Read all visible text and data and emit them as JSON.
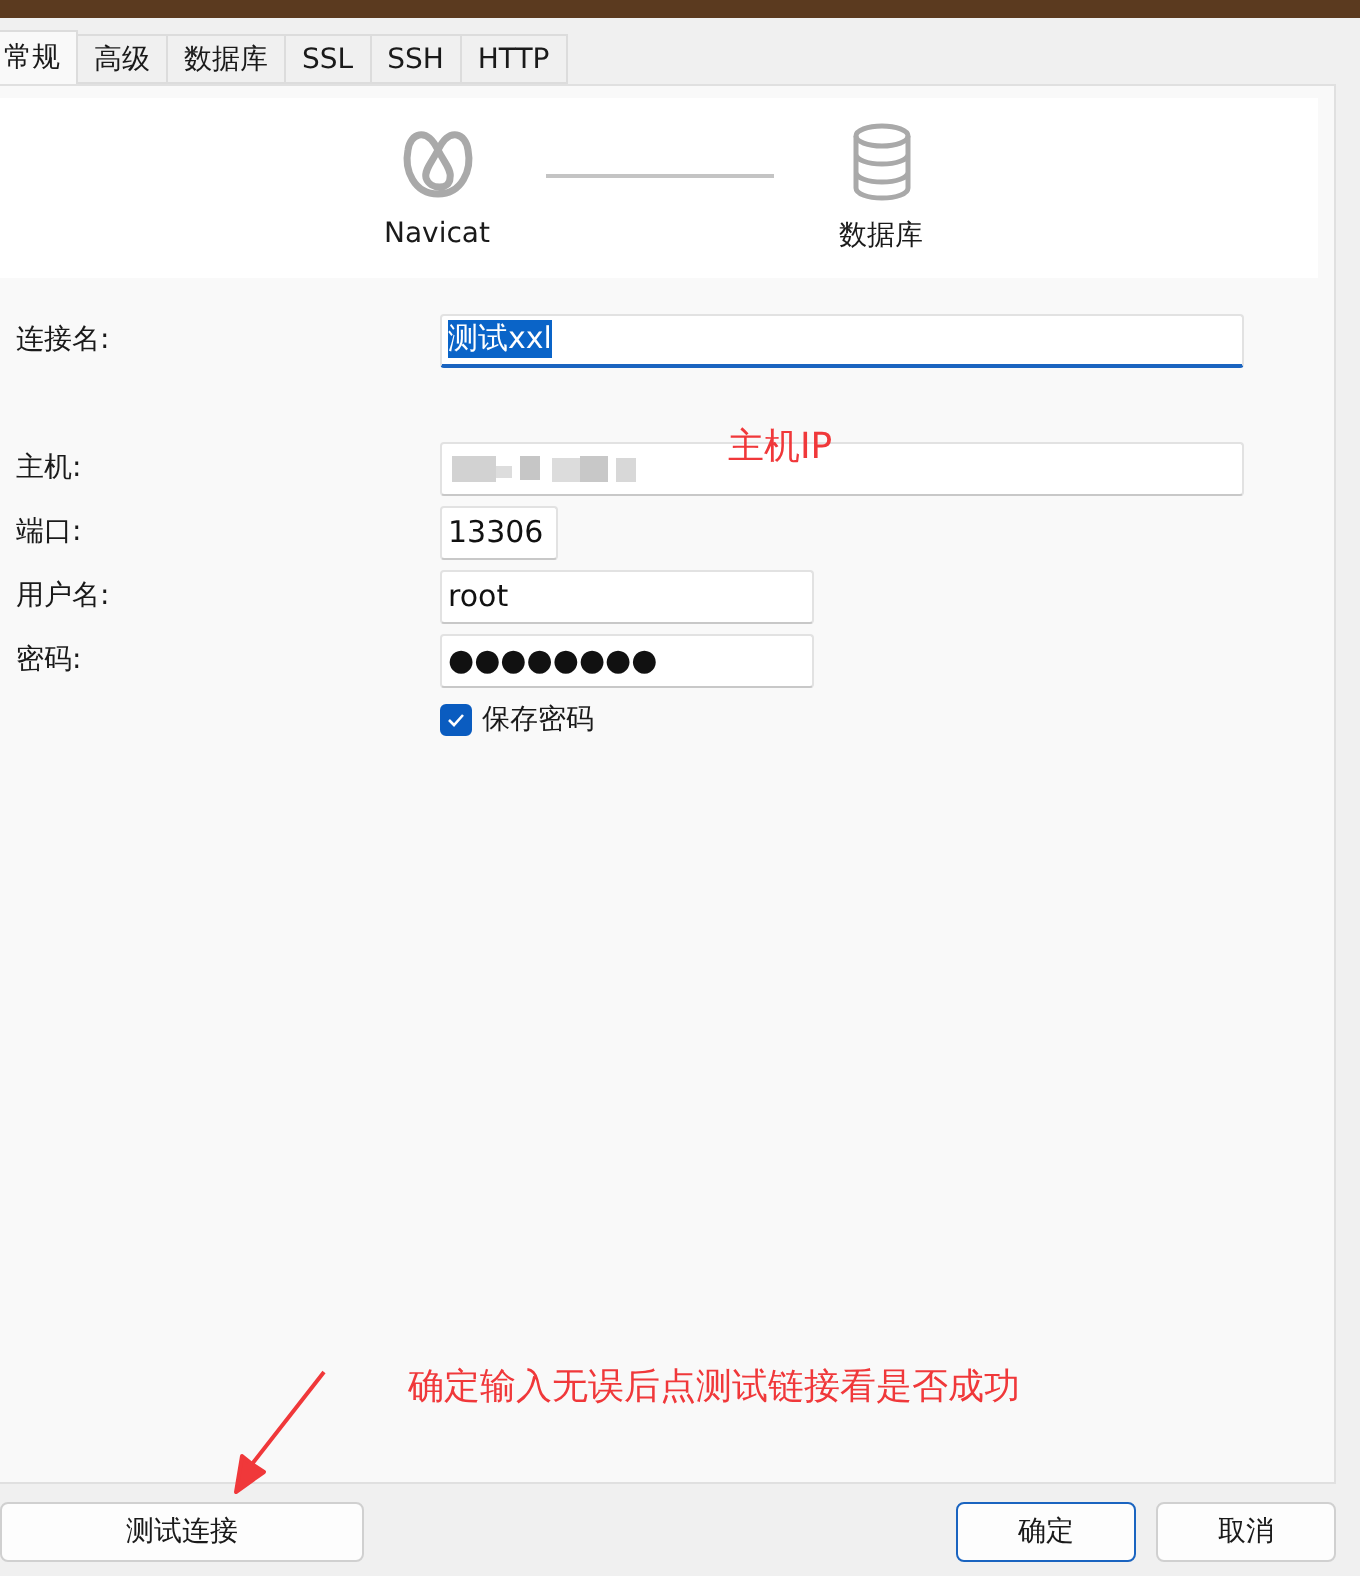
{
  "tabs": [
    {
      "label": "常规",
      "selected": true
    },
    {
      "label": "高级",
      "selected": false
    },
    {
      "label": "数据库",
      "selected": false
    },
    {
      "label": "SSL",
      "selected": false
    },
    {
      "label": "SSH",
      "selected": false
    },
    {
      "label": "HTTP",
      "selected": false
    }
  ],
  "header": {
    "source_label": "Navicat",
    "target_label": "数据库"
  },
  "fields": [
    {
      "kind": "text",
      "label": "连接名:",
      "value": "测试xxl",
      "focused": true,
      "text_selected": true
    },
    {
      "kind": "redacted",
      "label": "主机:",
      "focused": false
    },
    {
      "kind": "text",
      "label": "端口:",
      "value": "13306",
      "focused": false,
      "text_selected": false
    },
    {
      "kind": "text",
      "label": "用户名:",
      "value": "root",
      "focused": false,
      "text_selected": false
    },
    {
      "kind": "password",
      "label": "密码:",
      "value": "●●●●●●●●",
      "focused": false,
      "text_selected": false
    }
  ],
  "save_password": {
    "label": "保存密码",
    "checked": true
  },
  "annotations": {
    "host_note": "主机IP",
    "test_note": "确定输入无误后点测试链接看是否成功"
  },
  "buttons": [
    {
      "kind": "test",
      "label": "测试连接",
      "default": false
    },
    {
      "kind": "ok",
      "label": "确定",
      "default": true
    },
    {
      "kind": "cancel",
      "label": "取消",
      "default": false
    }
  ]
}
